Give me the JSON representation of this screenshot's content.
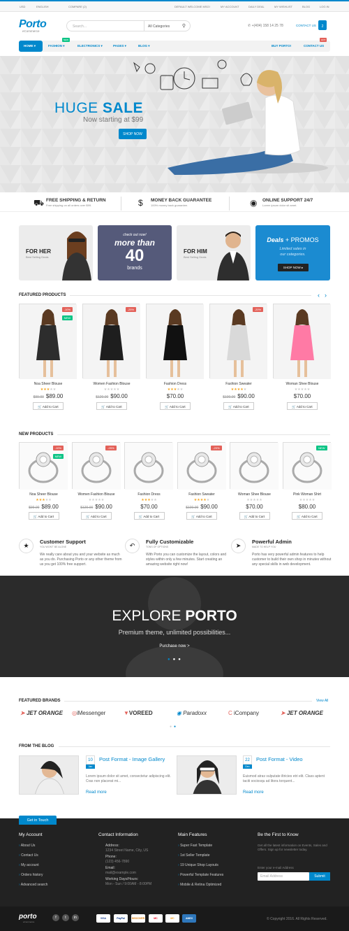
{
  "topbar": {
    "currency": "USD",
    "language": "ENGLISH",
    "compare": "COMPARE (2)",
    "welcome": "DEFAULT WELCOME MSG!",
    "links": [
      "MY ACCOUNT",
      "DAILY DEAL",
      "MY WISHLIST",
      "BLOG",
      "LOG IN"
    ]
  },
  "header": {
    "logo": "Porto",
    "logo_sub": "eCommerce",
    "search_placeholder": "Search...",
    "category": "All Categories",
    "phone": "+(404) 158 14 25 78",
    "contact": "CONTACT US",
    "cart_count": "2"
  },
  "nav": {
    "items": [
      "HOME",
      "FASHION",
      "ELECTRONICS",
      "PAGES",
      "BLOG"
    ],
    "right": [
      "BUY PORTO!",
      "CONTACT US"
    ],
    "badges": [
      "NEW",
      "HOT"
    ]
  },
  "hero": {
    "title_a": "HUGE",
    "title_b": "SALE",
    "subtitle": "Now starting at $99",
    "button": "SHOP NOW"
  },
  "features": [
    {
      "title": "FREE SHIPPING & RETURN",
      "sub": "Free shipping on all orders over $99."
    },
    {
      "title": "MONEY BACK GUARANTEE",
      "sub": "100% money back guarantee."
    },
    {
      "title": "ONLINE SUPPORT 24/7",
      "sub": "Lorem ipsum dolor sit amet."
    }
  ],
  "banners": {
    "her_title": "FOR HER",
    "her_sub": "Best Selling Deals",
    "brands_top": "check out now!",
    "brands_mid": "more than",
    "brands_num": "40",
    "brands_bot": "brands",
    "him_title": "FOR HIM",
    "him_sub": "Best Selling Deals",
    "deals_title": "Deals",
    "deals_plus": "+ PROMOS",
    "deals_sub1": "Limited sales in",
    "deals_sub2": "our categories.",
    "deals_btn": "SHOP NOW ▸"
  },
  "featured": {
    "title": "FEATURED PRODUCTS",
    "add_to_cart": "Add to Cart",
    "items": [
      {
        "name": "Noa Sheer Blouse",
        "old": "$99.00",
        "price": "$89.00",
        "tags": [
          "-10%",
          "NEW"
        ],
        "rating": 3
      },
      {
        "name": "Women Fashion Blouse",
        "old": "$120.00",
        "price": "$90.00",
        "tags": [
          "-25%"
        ],
        "rating": 0
      },
      {
        "name": "Fashion Dress",
        "old": "",
        "price": "$70.00",
        "tags": [],
        "rating": 3
      },
      {
        "name": "Fashion Sweater",
        "old": "$100.00",
        "price": "$90.00",
        "tags": [
          "-20%"
        ],
        "rating": 4
      },
      {
        "name": "Woman Shee Blouse",
        "old": "",
        "price": "$70.00",
        "tags": [],
        "rating": 0
      }
    ]
  },
  "newproducts": {
    "title": "NEW PRODUCTS",
    "add_to_cart": "Add to Cart",
    "items": [
      {
        "name": "Noa Sheer Blouse",
        "old": "$99.00",
        "price": "$89.00",
        "tags": [
          "-10%",
          "NEW"
        ],
        "rating": 3
      },
      {
        "name": "Women Fashion Blouse",
        "old": "$120.00",
        "price": "$90.00",
        "tags": [
          "-25%"
        ],
        "rating": 0
      },
      {
        "name": "Fashion Dress",
        "old": "",
        "price": "$70.00",
        "tags": [],
        "rating": 3
      },
      {
        "name": "Fashion Sweater",
        "old": "$100.00",
        "price": "$90.00",
        "tags": [
          "-20%"
        ],
        "rating": 4
      },
      {
        "name": "Woman Shee Blouse",
        "old": "",
        "price": "$70.00",
        "tags": [],
        "rating": 0
      },
      {
        "name": "Pink Woman Shirt",
        "old": "",
        "price": "$80.00",
        "tags": [
          "NEW"
        ],
        "rating": 0
      }
    ]
  },
  "services": [
    {
      "title": "Customer Support",
      "sub": "YOU WON'T BE ALONE",
      "desc": "We really care about you and your website as much as you do. Purchasing Porto or any other theme from us you get 100% free support."
    },
    {
      "title": "Fully Customizable",
      "sub": "TONS OF OPTIONS",
      "desc": "With Porto you can customize the layout, colors and styles within only a few minutes. Start creating an amazing website right now!"
    },
    {
      "title": "Powerful Admin",
      "sub": "MADE TO HELP YOU",
      "desc": "Porto has very powerful admin features to help customer to build their own shop in minutes without any special skills in web development."
    }
  ],
  "explore": {
    "title_a": "EXPLORE",
    "title_b": "PORTO",
    "subtitle": "Premium theme, unlimited possibilities...",
    "link": "Purchase now >"
  },
  "brands": {
    "title": "FEATURED BRANDS",
    "view_all": "View All",
    "items": [
      "JET ORANGE",
      "iMessenger",
      "VOREED",
      "Paradoxx",
      "iCompany",
      "JET ORANGE"
    ]
  },
  "blog": {
    "title": "FROM THE BLOG",
    "posts": [
      {
        "day": "10",
        "month": "Jan",
        "title": "Post Format - Image Gallery",
        "excerpt": "Lorem ipsum dolor sit amet, consectetur adipiscing elit. Cras non placerat mi...",
        "more": "Read more"
      },
      {
        "day": "22",
        "month": "Dec",
        "title": "Post Format - Video",
        "excerpt": "Euismod atras vulputate iltricies etri elit. Class aptent taciti sociosqu ad litora torquent...",
        "more": "Read more"
      }
    ]
  },
  "footer": {
    "tab": "Get in Touch",
    "account_title": "My Account",
    "account_links": [
      "About Us",
      "Contact Us",
      "My account",
      "Orders history",
      "Advanced search"
    ],
    "contact_title": "Contact Information",
    "address_label": "Address:",
    "address": "1234 Street Name, City, US",
    "phone_label": "Phone:",
    "phone": "(123) 456-7890",
    "email_label": "Email:",
    "email": "mail@example.com",
    "hours_label": "Working Days/Hours:",
    "hours": "Mon - Sun / 9:00AM - 8:00PM",
    "features_title": "Main Features",
    "features_links": [
      "Super Fast Template",
      "1st Seller Template",
      "19 Unique Shop Layouts",
      "Powerful Template Features",
      "Mobile & Retina Optimized"
    ],
    "news_title": "Be the First to Know",
    "news_desc": "Get all the latest information on Events, Sales and Offers. Sign up for newsletter today.",
    "news_label": "Enter your e-mail Address",
    "news_placeholder": "Email Address",
    "news_btn": "Submit",
    "logo": "porto",
    "logo_sub": "eCommerce",
    "payments": [
      "VISA",
      "PayPal",
      "DISCOVER",
      "MC",
      "MC",
      "AMEX"
    ],
    "copyright": "© Copyright 2016. All Rights Reserved."
  },
  "colors": {
    "accent": "#0088cc",
    "dark": "#222222",
    "sale_tag": "#e36159",
    "new_tag": "#0cc485",
    "star": "#f5a623"
  }
}
